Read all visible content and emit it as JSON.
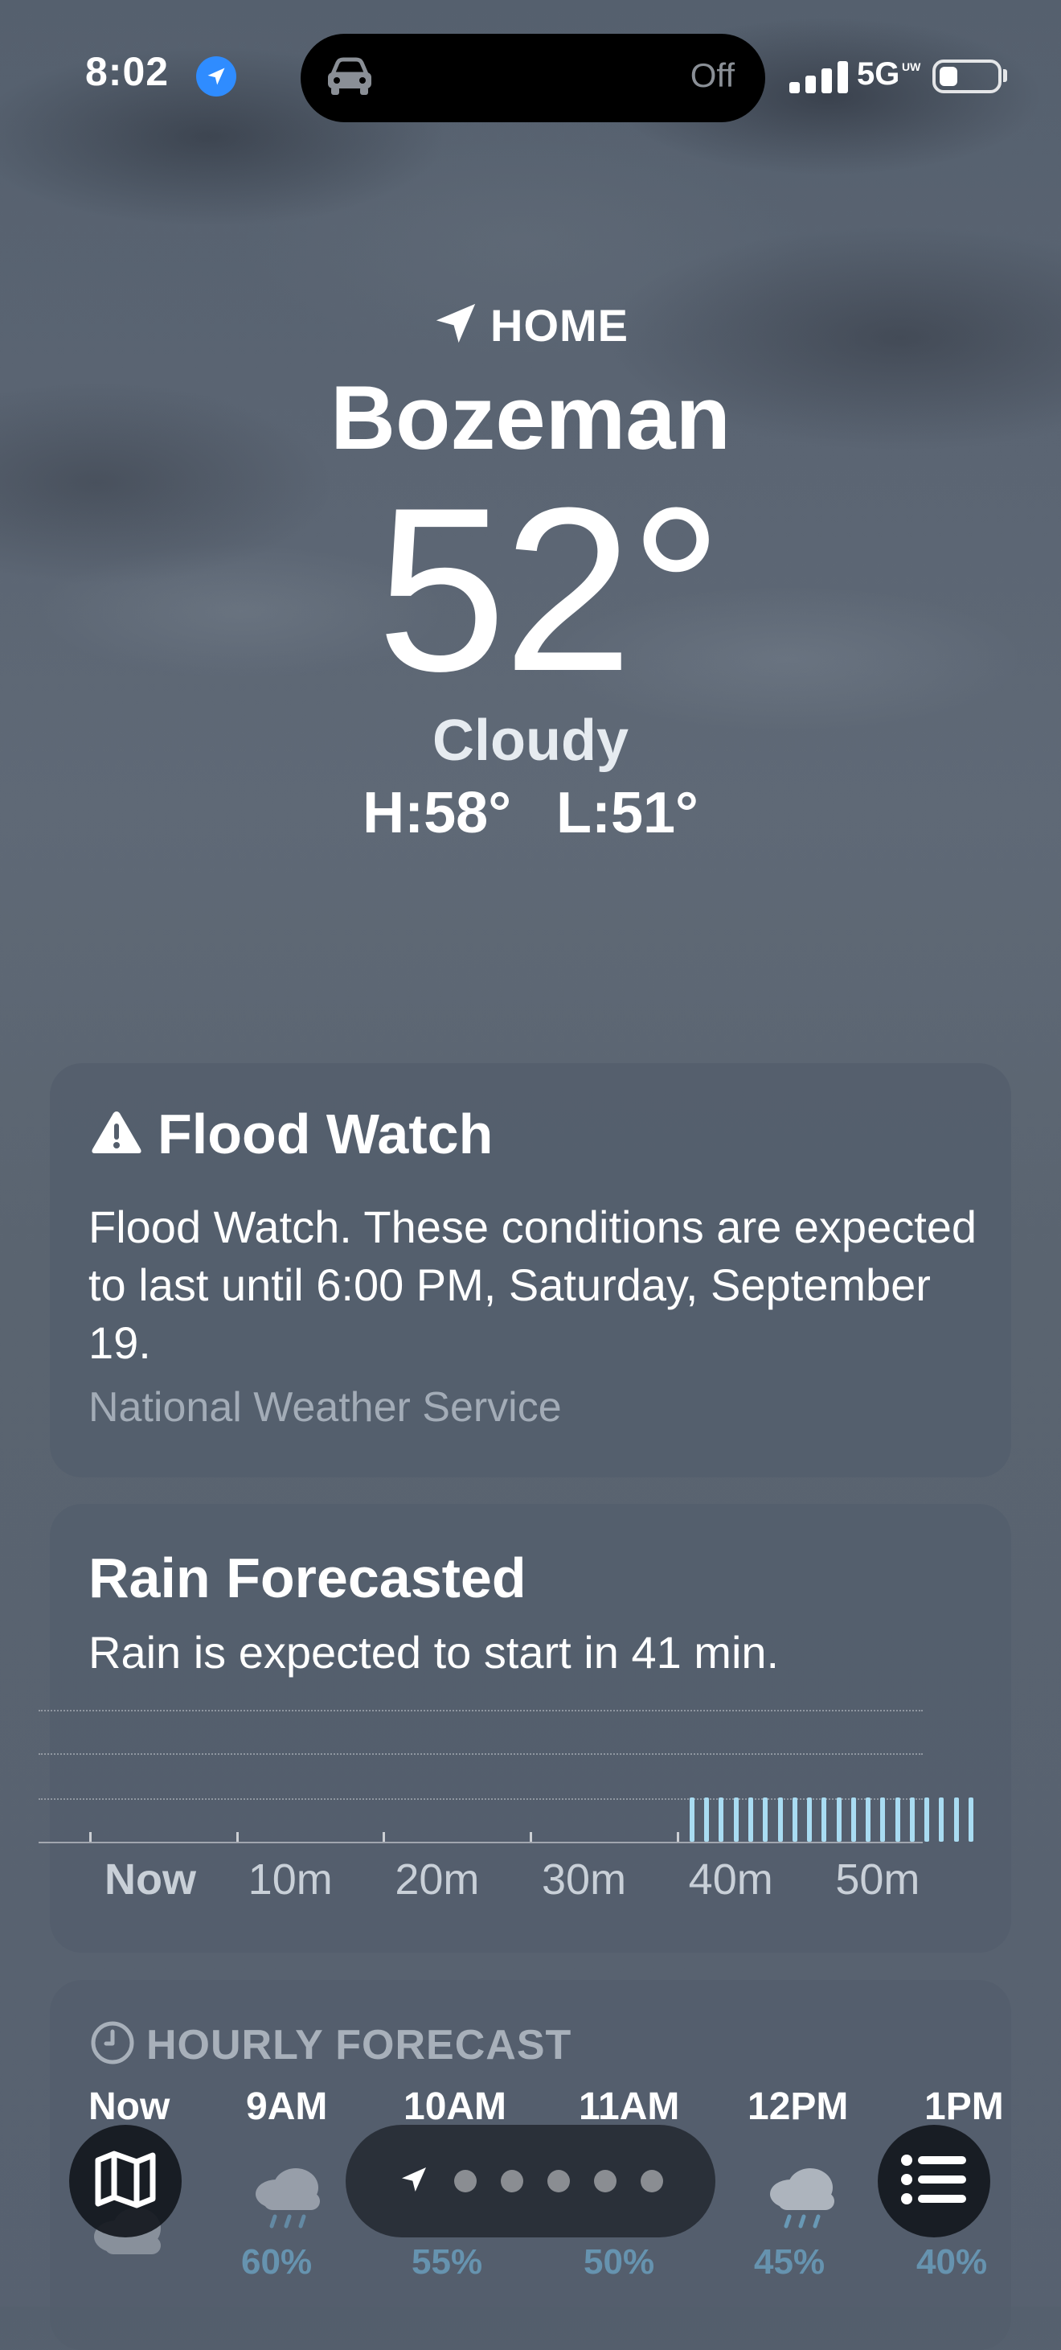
{
  "status": {
    "time": "8:02",
    "island_status": "Off",
    "network": "5G",
    "network_sub": "UW"
  },
  "hero": {
    "location_label": "HOME",
    "city": "Bozeman",
    "temperature": "52°",
    "condition": "Cloudy",
    "high": "H:58°",
    "low": "L:51°"
  },
  "alert": {
    "title": "Flood Watch",
    "body": "Flood Watch. These conditions are expected to last until 6:00 PM, Saturday, September 19.",
    "source": "National Weather Service"
  },
  "rain": {
    "title": "Rain Forecasted",
    "subtitle": "Rain is expected to start in 41 min.",
    "axis_labels": [
      "Now",
      "10m",
      "20m",
      "30m",
      "40m",
      "50m"
    ],
    "intensity_start_minute": 41,
    "intensity_end_minute": 60,
    "intensity_level": 0.33
  },
  "hourly": {
    "header": "HOURLY FORECAST",
    "items": [
      {
        "time": "Now",
        "icon": "cloud-icon",
        "precip": ""
      },
      {
        "time": "9AM",
        "icon": "cloud-rain-icon",
        "precip": "60%"
      },
      {
        "time": "10AM",
        "icon": "cloud-rain-icon",
        "precip": "55%"
      },
      {
        "time": "11AM",
        "icon": "cloud-rain-icon",
        "precip": "50%"
      },
      {
        "time": "12PM",
        "icon": "cloud-rain-icon",
        "precip": "45%"
      },
      {
        "time": "1PM",
        "icon": "cloud-rain-icon",
        "precip": "40%"
      }
    ]
  },
  "toolbar": {
    "map_icon": "map-icon",
    "list_icon": "list-icon",
    "page_count": 6,
    "current_page": 1
  },
  "colors": {
    "rain_bar": "#a9dcf2",
    "location_badge": "#2f8cff",
    "precip_text": "#76bfe6"
  }
}
